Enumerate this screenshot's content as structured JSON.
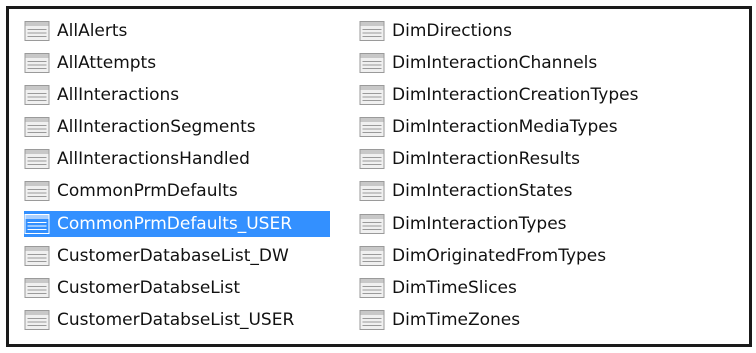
{
  "colors": {
    "selection": "#3390ff",
    "text": "#111111",
    "selected_text": "#ffffff",
    "icon_border": "#9a9a9a",
    "icon_fill": "#f0f0f0",
    "icon_header": "#c8c8c8"
  },
  "list": {
    "icon": "table-icon",
    "left_column": [
      {
        "label": "AllAlerts"
      },
      {
        "label": "AllAttempts"
      },
      {
        "label": "AllInteractions"
      },
      {
        "label": "AllInteractionSegments"
      },
      {
        "label": "AllInteractionsHandled"
      },
      {
        "label": "CommonPrmDefaults"
      },
      {
        "label": "CommonPrmDefaults_USER",
        "selected": true
      },
      {
        "label": "CustomerDatabaseList_DW"
      },
      {
        "label": "CustomerDatabseList"
      },
      {
        "label": "CustomerDatabseList_USER"
      }
    ],
    "right_column": [
      {
        "label": "DimDirections"
      },
      {
        "label": "DimInteractionChannels"
      },
      {
        "label": "DimInteractionCreationTypes"
      },
      {
        "label": "DimInteractionMediaTypes"
      },
      {
        "label": "DimInteractionResults"
      },
      {
        "label": "DimInteractionStates"
      },
      {
        "label": "DimInteractionTypes"
      },
      {
        "label": "DimOriginatedFromTypes"
      },
      {
        "label": "DimTimeSlices"
      },
      {
        "label": "DimTimeZones"
      }
    ]
  }
}
